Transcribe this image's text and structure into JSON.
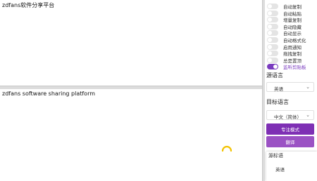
{
  "source_text": "zdfans软件分享平台",
  "target_text": "zdfans software sharing platform",
  "toggles": [
    {
      "label": "自动复制",
      "on": false
    },
    {
      "label": "自动粘贴",
      "on": false
    },
    {
      "label": "增量复制",
      "on": false
    },
    {
      "label": "自动隐藏",
      "on": false
    },
    {
      "label": "自动显示",
      "on": false
    },
    {
      "label": "自动格式化",
      "on": false
    },
    {
      "label": "启用通知",
      "on": false
    },
    {
      "label": "拖拽复制",
      "on": false
    },
    {
      "label": "总是置顶",
      "on": false
    },
    {
      "label": "监听剪贴板",
      "on": true
    }
  ],
  "source_language": {
    "label": "源语言",
    "value": "英语"
  },
  "target_language": {
    "label": "目标语言",
    "value": "中文（简体）"
  },
  "buttons": {
    "focus_mode": "专注模式",
    "translate": "翻译"
  },
  "popup": {
    "title": "源标语",
    "value": "英语"
  },
  "colors": {
    "accent": "#7e2fb4",
    "accent_light": "#9b52c4",
    "switch_off": "#e4e4e4"
  }
}
